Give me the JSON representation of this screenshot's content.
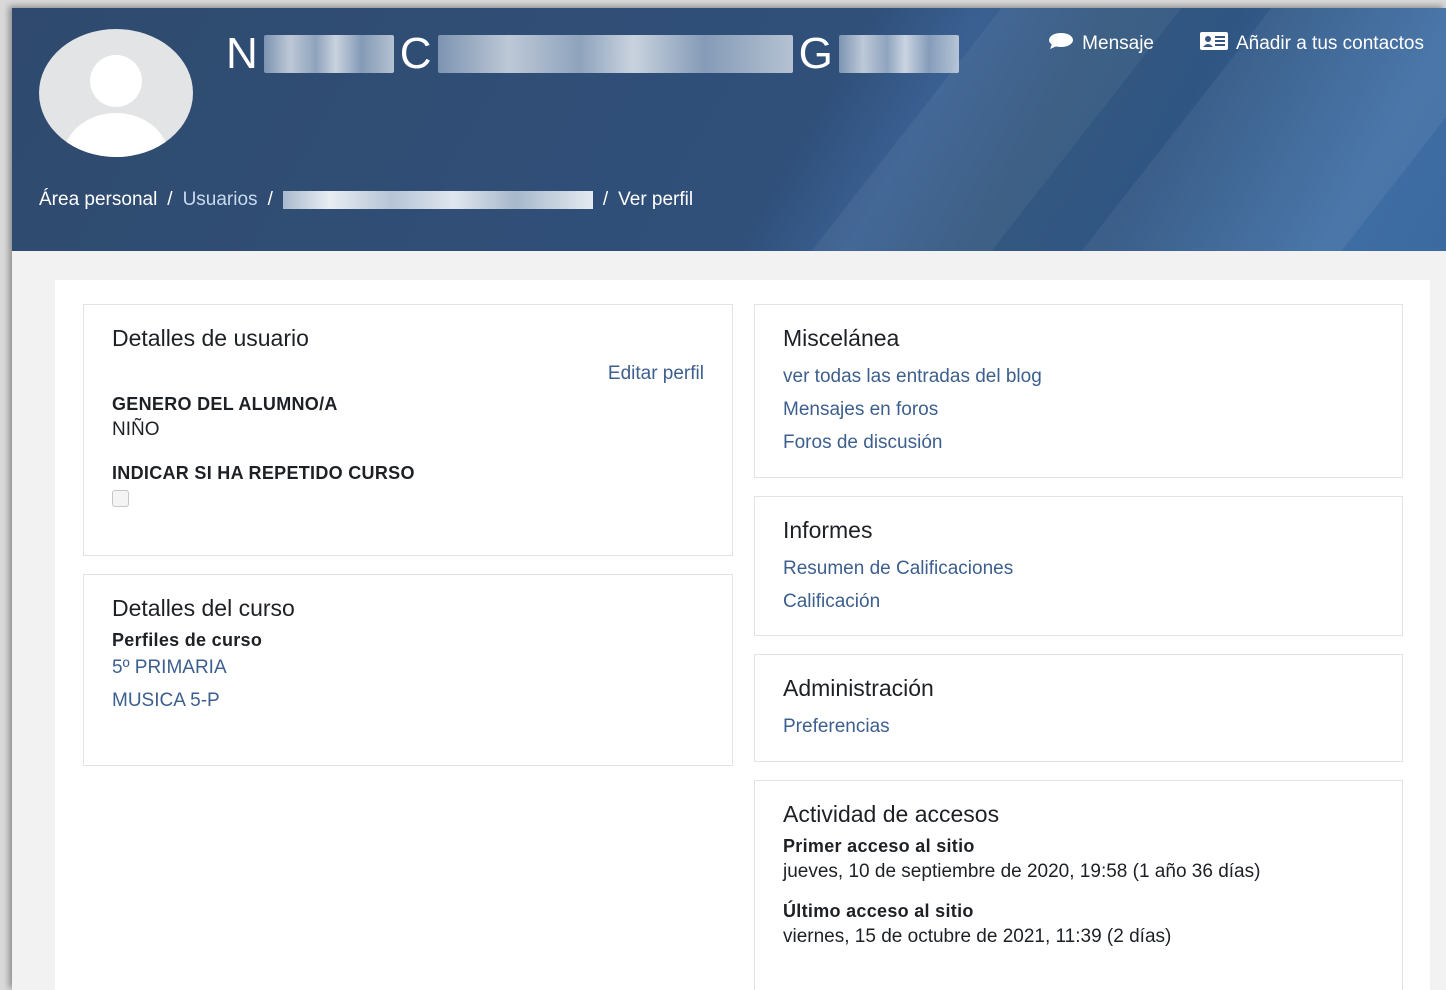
{
  "header": {
    "user_name": {
      "initials": [
        "N",
        "C",
        "G"
      ]
    },
    "actions": {
      "message": "Mensaje",
      "add_contact": "Añadir a tus contactos"
    },
    "breadcrumb": {
      "home": "Área personal",
      "users": "Usuarios",
      "separator": "/",
      "current": "Ver perfil"
    }
  },
  "user_details": {
    "title": "Detalles de usuario",
    "edit_profile": "Editar perfil",
    "gender_label": "GENERO DEL ALUMNO/A",
    "gender_value": "NIÑO",
    "repeated_label": "INDICAR SI HA REPETIDO CURSO"
  },
  "course_details": {
    "title": "Detalles del curso",
    "profiles_label": "Perfiles de curso",
    "courses": [
      "5º PRIMARIA",
      "MUSICA 5-P"
    ]
  },
  "misc": {
    "title": "Miscelánea",
    "links": [
      "ver todas las entradas del blog",
      "Mensajes en foros",
      "Foros de discusión"
    ]
  },
  "reports": {
    "title": "Informes",
    "links": [
      "Resumen de Calificaciones",
      "Calificación"
    ]
  },
  "administration": {
    "title": "Administración",
    "links": [
      "Preferencias"
    ]
  },
  "access": {
    "title": "Actividad de accesos",
    "first_label": "Primer acceso al sitio",
    "first_value": "jueves, 10 de septiembre de 2020, 19:58  (1 año 36 días)",
    "last_label": "Último acceso al sitio",
    "last_value": "viernes, 15 de octubre de 2021, 11:39  (2 días)"
  }
}
